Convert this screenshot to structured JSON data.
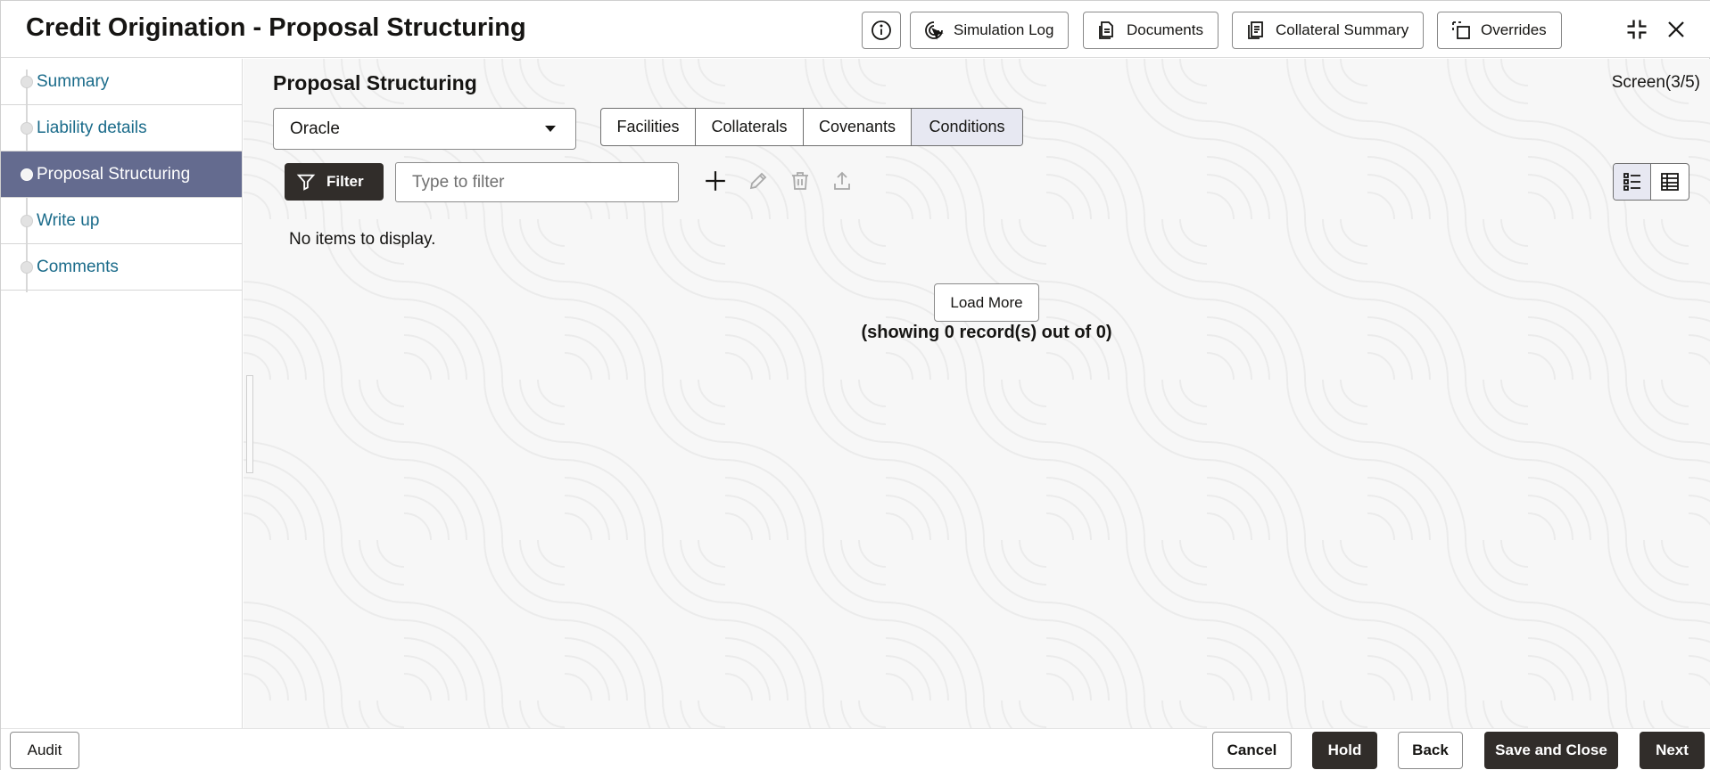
{
  "header": {
    "title": "Credit Origination - Proposal Structuring",
    "buttons": {
      "simulation_log": "Simulation Log",
      "documents": "Documents",
      "collateral_summary": "Collateral Summary",
      "overrides": "Overrides"
    },
    "icons": [
      "info-icon",
      "simulation-log-icon",
      "documents-icon",
      "collateral-summary-icon",
      "overrides-icon",
      "collapse-icon",
      "close-icon"
    ]
  },
  "sidebar": {
    "items": [
      {
        "label": "Summary",
        "active": false
      },
      {
        "label": "Liability details",
        "active": false
      },
      {
        "label": "Proposal Structuring",
        "active": true
      },
      {
        "label": "Write up",
        "active": false
      },
      {
        "label": "Comments",
        "active": false
      }
    ]
  },
  "main": {
    "title": "Proposal Structuring",
    "screen_count": "Screen(3/5)",
    "select_value": "Oracle",
    "tabs": [
      {
        "label": "Facilities",
        "active": false
      },
      {
        "label": "Collaterals",
        "active": false
      },
      {
        "label": "Covenants",
        "active": false
      },
      {
        "label": "Conditions",
        "active": true
      }
    ],
    "filter_label": "Filter",
    "filter_placeholder": "Type to filter",
    "empty_text": "No items to display.",
    "load_more": "Load More",
    "record_count": "(showing 0 record(s) out of 0)"
  },
  "footer": {
    "audit": "Audit",
    "cancel": "Cancel",
    "hold": "Hold",
    "back": "Back",
    "save_and_close": "Save and Close",
    "next": "Next"
  },
  "colors": {
    "active_nav": "#646b8f",
    "dark_button": "#312d2a",
    "link": "#1a6b8a",
    "active_tab": "#e7e8f2"
  }
}
